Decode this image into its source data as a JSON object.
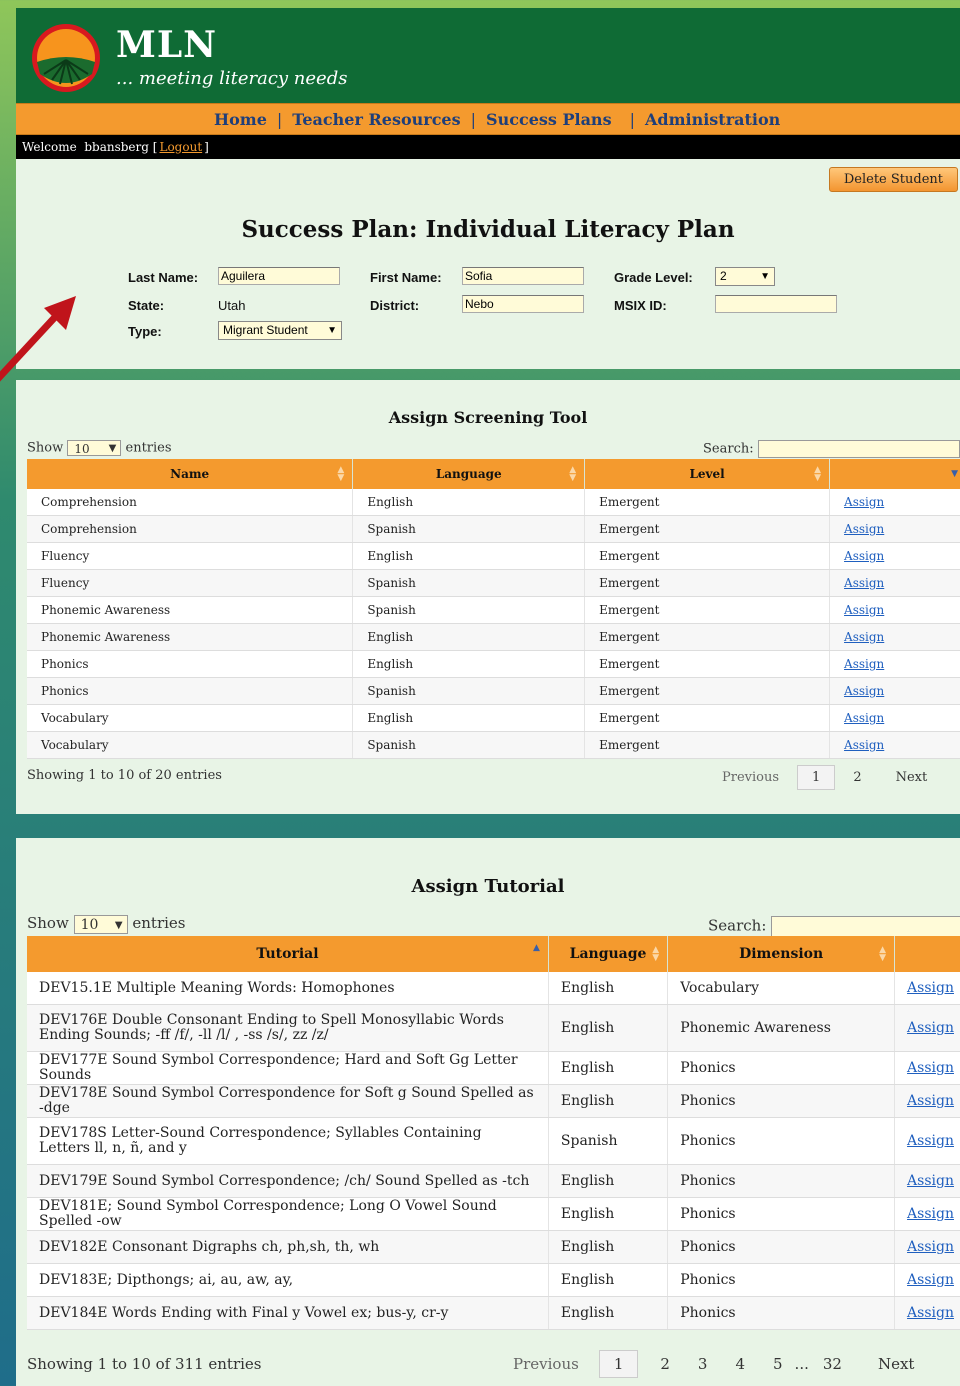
{
  "brand": {
    "title": "MLN",
    "tagline": "... meeting literacy needs"
  },
  "nav": {
    "items": [
      "Home",
      "Teacher Resources",
      "Success Plans",
      "Administration"
    ],
    "separator": "|"
  },
  "welcome": {
    "text": "Welcome  bbansberg",
    "logout": "Logout",
    "open": "[",
    "close": "]"
  },
  "actions": {
    "delete": "Delete Student"
  },
  "plan": {
    "title": "Success Plan: Individual Literacy Plan",
    "last_name_label": "Last Name:",
    "last_name": "Aguilera",
    "first_name_label": "First Name:",
    "first_name": "Sofia",
    "grade_label": "Grade Level:",
    "grade": "2",
    "state_label": "State:",
    "state": "Utah",
    "district_label": "District:",
    "district": "Nebo",
    "msix_label": "MSIX ID:",
    "msix": "",
    "type_label": "Type:",
    "type": "Migrant Student"
  },
  "screening": {
    "title": "Assign Screening Tool",
    "show": "Show",
    "show_value": "10",
    "entries": "entries",
    "search": "Search:",
    "headers": [
      "Name",
      "Language",
      "Level",
      ""
    ],
    "rows": [
      [
        "Comprehension",
        "English",
        "Emergent",
        "Assign"
      ],
      [
        "Comprehension",
        "Spanish",
        "Emergent",
        "Assign"
      ],
      [
        "Fluency",
        "English",
        "Emergent",
        "Assign"
      ],
      [
        "Fluency",
        "Spanish",
        "Emergent",
        "Assign"
      ],
      [
        "Phonemic Awareness",
        "Spanish",
        "Emergent",
        "Assign"
      ],
      [
        "Phonemic Awareness",
        "English",
        "Emergent",
        "Assign"
      ],
      [
        "Phonics",
        "English",
        "Emergent",
        "Assign"
      ],
      [
        "Phonics",
        "Spanish",
        "Emergent",
        "Assign"
      ],
      [
        "Vocabulary",
        "English",
        "Emergent",
        "Assign"
      ],
      [
        "Vocabulary",
        "Spanish",
        "Emergent",
        "Assign"
      ]
    ],
    "info": "Showing 1 to 10 of 20 entries",
    "previous": "Previous",
    "pages": [
      "1",
      "2"
    ],
    "next": "Next"
  },
  "tutorial": {
    "title": "Assign Tutorial",
    "show": "Show",
    "show_value": "10",
    "entries": "entries",
    "search": "Search:",
    "headers": [
      "Tutorial",
      "Language",
      "Dimension",
      ""
    ],
    "rows": [
      [
        "DEV15.1E Multiple Meaning Words: Homophones",
        "English",
        "Vocabulary",
        "Assign"
      ],
      [
        "DEV176E Double Consonant Ending to Spell Monosyllabic Words Ending Sounds; -ff /f/, -ll /l/ , -ss /s/, zz /z/",
        "English",
        "Phonemic Awareness",
        "Assign"
      ],
      [
        "DEV177E Sound Symbol Correspondence; Hard and Soft Gg Letter Sounds",
        "English",
        "Phonics",
        "Assign"
      ],
      [
        "DEV178E Sound Symbol Correspondence for Soft g Sound Spelled as -dge",
        "English",
        "Phonics",
        "Assign"
      ],
      [
        "DEV178S Letter-Sound Correspondence; Syllables Containing Letters ll, n, ñ, and y",
        "Spanish",
        "Phonics",
        "Assign"
      ],
      [
        "DEV179E Sound Symbol Correspondence; /ch/ Sound Spelled as -tch",
        "English",
        "Phonics",
        "Assign"
      ],
      [
        "DEV181E; Sound Symbol Correspondence; Long O Vowel Sound Spelled -ow",
        "English",
        "Phonics",
        "Assign"
      ],
      [
        "DEV182E Consonant Digraphs ch, ph,sh, th, wh",
        "English",
        "Phonics",
        "Assign"
      ],
      [
        "DEV183E; Dipthongs; ai, au, aw, ay,",
        "English",
        "Phonics",
        "Assign"
      ],
      [
        "DEV184E Words Ending with Final y Vowel ex; bus-y, cr-y",
        "English",
        "Phonics",
        "Assign"
      ]
    ],
    "info": "Showing 1 to 10 of 311 entries",
    "previous": "Previous",
    "pages": [
      "1",
      "2",
      "3",
      "4",
      "5"
    ],
    "ellipsis": "...",
    "last_page": "32",
    "next": "Next"
  },
  "icons": {
    "logo": "field-sunset-logo",
    "annotation": "red-arrow-icon",
    "sort": "sort-icon",
    "dropdown": "chevron-down-icon"
  },
  "colors": {
    "header_green": "#0f6b35",
    "nav_orange": "#f49a2e",
    "link_blue": "#1f5fbf",
    "panel_bg": "#e8f4e6",
    "arrow_red": "#c0141b"
  }
}
